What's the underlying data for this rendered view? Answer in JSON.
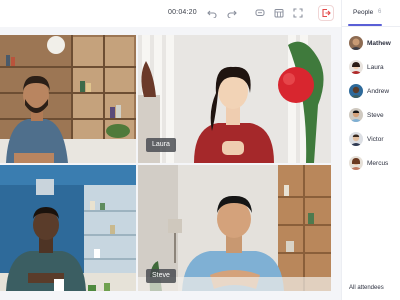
{
  "toolbar": {
    "timer": "00:04:20",
    "buttons": [
      "undo-icon",
      "redo-icon",
      "chat-icon",
      "calendar-icon",
      "fullscreen-icon",
      "leave-icon"
    ],
    "end_color": "#e34a4a"
  },
  "video": {
    "tiles": [
      {
        "id": "tile-1",
        "name": ""
      },
      {
        "id": "tile-2",
        "name": "Laura"
      },
      {
        "id": "tile-3",
        "name": ""
      },
      {
        "id": "tile-4",
        "name": "Steve"
      }
    ]
  },
  "panel": {
    "tab_people": "People",
    "tab_count": "6",
    "accent": "#5a5fd6",
    "participants": [
      {
        "name": "Mathew",
        "bold": true
      },
      {
        "name": "Laura",
        "bold": false
      },
      {
        "name": "Andrew",
        "bold": false
      },
      {
        "name": "Steve",
        "bold": false
      },
      {
        "name": "Victor",
        "bold": false
      },
      {
        "name": "Mercus",
        "bold": false
      }
    ],
    "footer": "All attendees"
  }
}
